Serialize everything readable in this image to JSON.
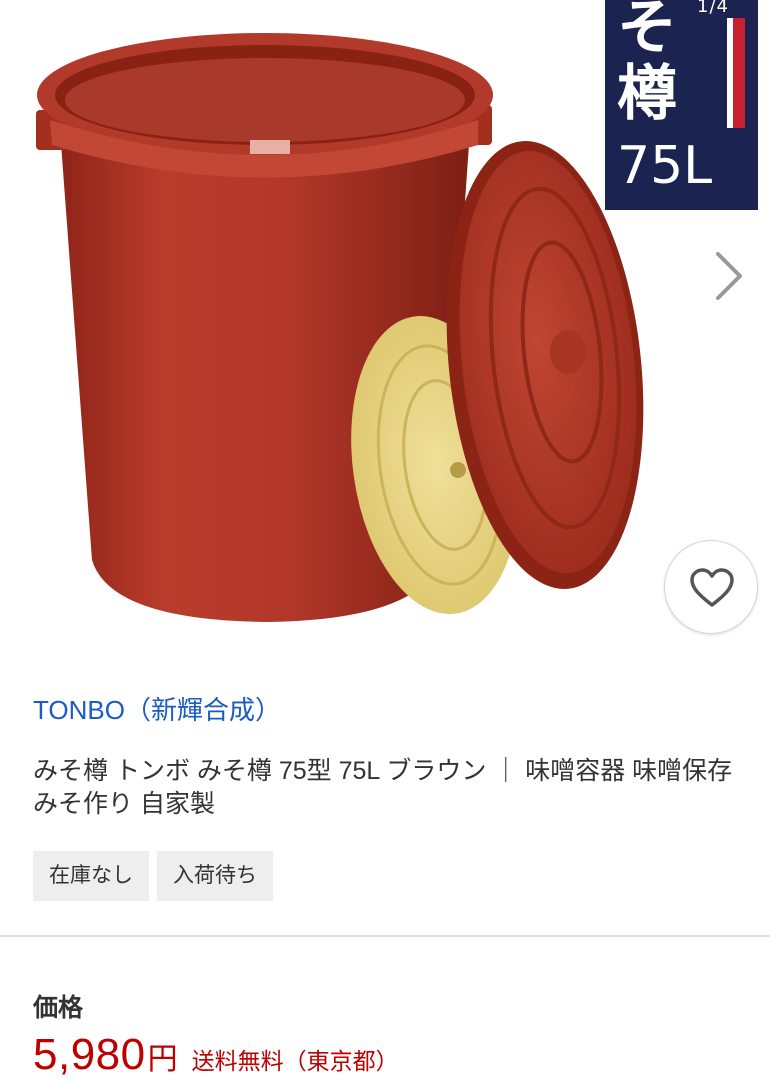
{
  "gallery": {
    "counter": "1/4",
    "badge": {
      "line1": "そ",
      "line2": "樽",
      "line3": "75L"
    },
    "icons": {
      "next": "chevron-right-icon",
      "favorite": "heart-icon"
    }
  },
  "product": {
    "brand": "TONBO（新輝合成）",
    "title": "みそ樽 トンボ みそ樽 75型 75L ブラウン ｜ 味噌容器 味噌保存 みそ作り 自家製",
    "tags": [
      "在庫なし",
      "入荷待ち"
    ]
  },
  "price": {
    "label": "価格",
    "value": "5,980",
    "unit": "円",
    "shipping": "送料無料（東京都）"
  },
  "colors": {
    "brand_link": "#1a5bc4",
    "price": "#bf0000",
    "badge_bg": "#1b2350",
    "barrel": "#b0372a",
    "inner_lid": "#e8d57c"
  }
}
